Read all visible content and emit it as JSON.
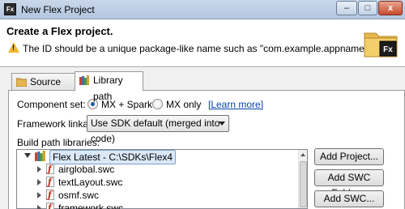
{
  "window": {
    "title": "New Flex Project",
    "app_icon_text": "Fx",
    "controls": {
      "minimize": "–",
      "maximize": "□",
      "close": "x"
    }
  },
  "header": {
    "title": "Create a Flex project.",
    "message": "The ID should be a unique package-like name such as \"com.example.appname\".",
    "logo_text": "Fx"
  },
  "tabs": [
    {
      "label": "Source path",
      "active": false
    },
    {
      "label": "Library path",
      "active": true
    }
  ],
  "component_set": {
    "label": "Component set:",
    "options": [
      {
        "label": "MX + Spark",
        "checked": true
      },
      {
        "label": "MX only",
        "checked": false
      }
    ],
    "learn_more": "[Learn more]"
  },
  "framework_linkage": {
    "label": "Framework linkage:",
    "value": "Use SDK default (merged into code)"
  },
  "build_path": {
    "label": "Build path libraries:",
    "root": "Flex Latest - C:\\SDKs\\Flex4",
    "items": [
      "airglobal.swc",
      "textLayout.swc",
      "osmf.swc",
      "framework.swc"
    ]
  },
  "buttons": {
    "add_project": "Add Project...",
    "add_swc_folder": "Add SWC Folder...",
    "add_swc": "Add SWC..."
  },
  "colors": {
    "link": "#0645ad",
    "selection": "#dbe8f8",
    "titlebar": "#c9d7ea"
  }
}
